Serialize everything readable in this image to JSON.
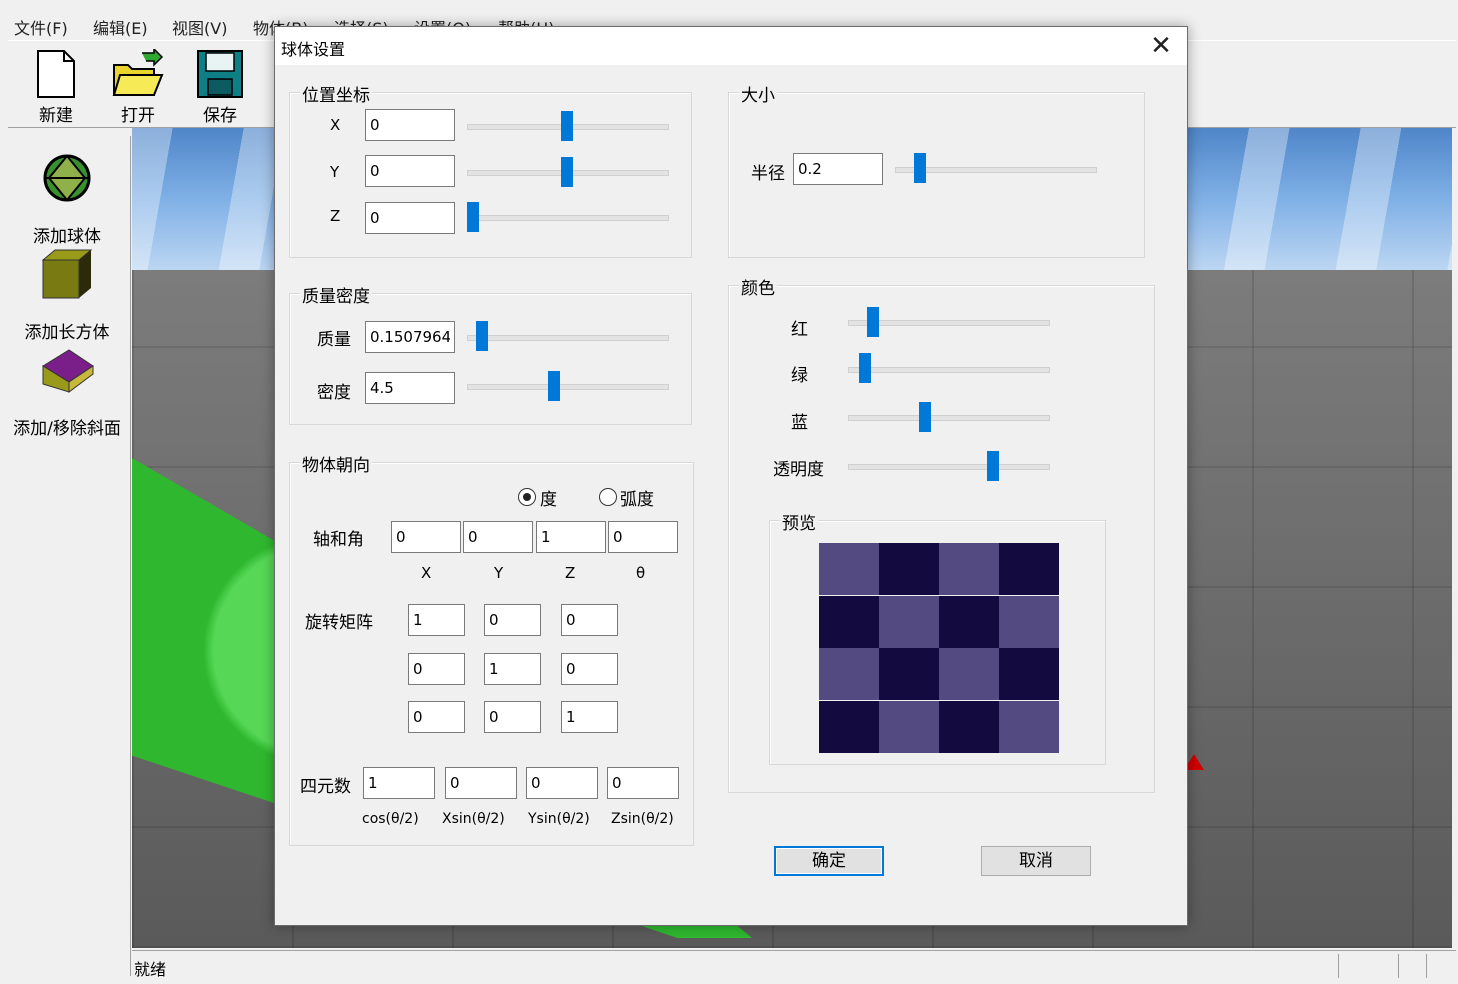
{
  "menubar": {
    "items": [
      "文件(F)",
      "编辑(E)",
      "视图(V)",
      "物体(B)",
      "选择(S)",
      "设置(O)",
      "帮助(H)"
    ]
  },
  "toolbar": {
    "new_label": "新建",
    "new_icon": "new-file-icon",
    "open_label": "打开",
    "open_icon": "open-folder-icon",
    "save_label": "保存",
    "save_icon": "floppy-disk-icon"
  },
  "sidepanel": {
    "add_sphere": "添加球体",
    "add_box": "添加长方体",
    "toggle_slope": "添加/移除斜面"
  },
  "status": {
    "text": "就绪"
  },
  "dialog": {
    "title": "球体设置",
    "close": "✕",
    "position": {
      "title": "位置坐标",
      "x_label": "X",
      "x_value": "0",
      "x_slider": 0.5,
      "y_label": "Y",
      "y_value": "0",
      "y_slider": 0.5,
      "z_label": "Z",
      "z_value": "0",
      "z_slider": 0.0
    },
    "mass_density": {
      "title": "质量密度",
      "mass_label": "质量",
      "mass_value": "0.1507964",
      "mass_slider": 0.05,
      "density_label": "密度",
      "density_value": "4.5",
      "density_slider": 0.43
    },
    "orientation": {
      "title": "物体朝向",
      "unit_degree": "度",
      "unit_radian": "弧度",
      "selected_unit": "度",
      "axis_angle_label": "轴和角",
      "axis_angle_values": [
        "0",
        "0",
        "1",
        "0"
      ],
      "axis_angle_headers": [
        "X",
        "Y",
        "Z",
        "θ"
      ],
      "rotation_label": "旋转矩阵",
      "rotation_matrix": [
        [
          "1",
          "0",
          "0"
        ],
        [
          "0",
          "1",
          "0"
        ],
        [
          "0",
          "0",
          "1"
        ]
      ],
      "quaternion_label": "四元数",
      "quaternion_values": [
        "1",
        "0",
        "0",
        "0"
      ],
      "quaternion_headers": [
        "cos(θ/2)",
        "Xsin(θ/2)",
        "Ysin(θ/2)",
        "Zsin(θ/2)"
      ]
    },
    "size": {
      "title": "大小",
      "radius_label": "半径",
      "radius_value": "0.2",
      "radius_slider": 0.1
    },
    "color": {
      "title": "颜色",
      "red_label": "红",
      "red_slider": 0.1,
      "green_label": "绿",
      "green_slider": 0.06,
      "blue_label": "蓝",
      "blue_slider": 0.38,
      "alpha_label": "透明度",
      "alpha_slider": 0.74,
      "preview_label": "预览",
      "preview_light": "#544a82",
      "preview_dark": "#130b40"
    },
    "ok_label": "确定",
    "cancel_label": "取消"
  }
}
